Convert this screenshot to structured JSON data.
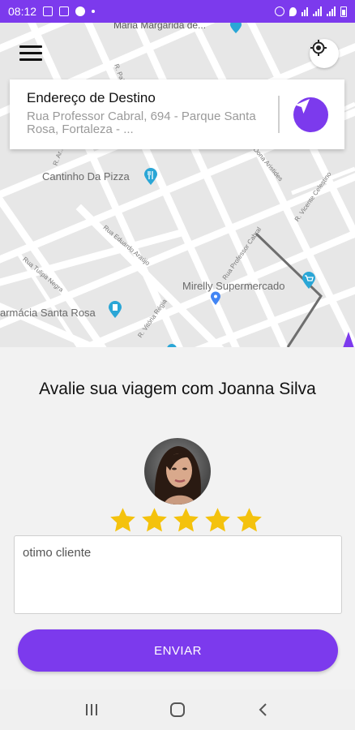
{
  "status_bar": {
    "time": "08:12",
    "bg_color": "#7c3aed"
  },
  "map": {
    "labels": {
      "top_street": "Maria Margarida de...",
      "pizza": "Cantinho Da Pizza",
      "supermarket": "Mirelly Supermercado",
      "pharmacy": "armácia Santa Rosa",
      "street_eduardo": "Rua Eduardo Araújo",
      "street_tulipa": "Rua Tulipa Negra",
      "street_vitoria": "R. Vitória Régia",
      "street_cabral": "Rua Professor Cabral",
      "street_celestino": "R. Vicente Celestino",
      "street_arnaldo": "R. Ar...",
      "street_aristides": "Dona Aristides",
      "street_pal": "R. Pal..."
    },
    "icons": {
      "menu": "hamburger-menu-icon",
      "locate": "crosshair-icon"
    }
  },
  "address": {
    "title": "Endereço de Destino",
    "value": "Rua Professor Cabral, 694 - Parque Santa Rosa, Fortaleza - ..."
  },
  "rating": {
    "title": "Avalie sua viagem com Joanna Silva",
    "stars_selected": 5,
    "stars_total": 5,
    "star_color": "#f4c20d"
  },
  "comment": {
    "value": "otimo cliente"
  },
  "actions": {
    "send_label": "ENVIAR"
  },
  "colors": {
    "accent": "#7c3aed",
    "map_bg": "#e7e7e7",
    "road": "#ffffff"
  }
}
